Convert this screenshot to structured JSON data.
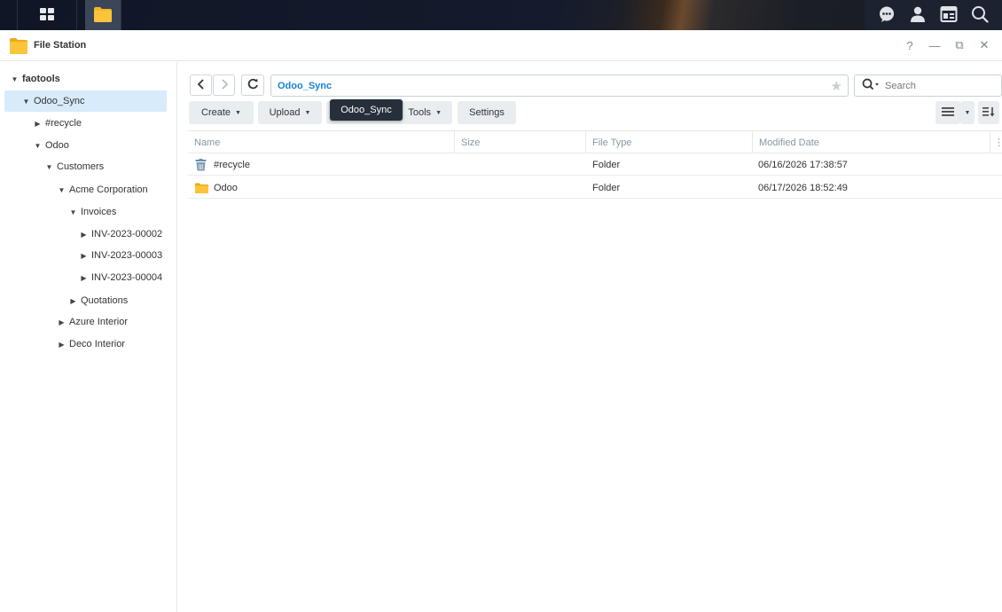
{
  "taskbar": {
    "main_menu_icon": "grid-icon",
    "app_icon": "folder-icon",
    "right_icons": [
      "chat-icon",
      "user-icon",
      "widgets-icon",
      "search-icon"
    ]
  },
  "window": {
    "title": "File Station",
    "controls": {
      "help": "?",
      "minimize": "—",
      "restore": "⧉",
      "close": "✕"
    }
  },
  "sidebar": {
    "root": "faotools",
    "items": [
      {
        "label": "Odoo_Sync",
        "expanded": true,
        "selected": true
      },
      {
        "label": "#recycle",
        "expanded": false
      },
      {
        "label": "Odoo",
        "expanded": true
      },
      {
        "label": "Customers",
        "expanded": true
      },
      {
        "label": "Acme Corporation",
        "expanded": true
      },
      {
        "label": "Invoices",
        "expanded": true
      },
      {
        "label": "INV-2023-00002",
        "expanded": false
      },
      {
        "label": "INV-2023-00003",
        "expanded": false
      },
      {
        "label": "INV-2023-00004",
        "expanded": false
      },
      {
        "label": "Quotations",
        "expanded": false
      },
      {
        "label": "Azure Interior",
        "expanded": false
      },
      {
        "label": "Deco Interior",
        "expanded": false
      }
    ]
  },
  "path": {
    "current": "Odoo_Sync",
    "search_placeholder": "Search"
  },
  "toolbar": {
    "create": "Create",
    "upload": "Upload",
    "tools": "Tools",
    "settings": "Settings",
    "tooltip": "Odoo_Sync"
  },
  "table": {
    "columns": [
      "Name",
      "Size",
      "File Type",
      "Modified Date"
    ],
    "rows": [
      {
        "icon": "trash-icon",
        "name": "#recycle",
        "size": "",
        "type": "Folder",
        "modified": "06/16/2026 17:38:57"
      },
      {
        "icon": "folder-icon",
        "name": "Odoo",
        "size": "",
        "type": "Folder",
        "modified": "06/17/2026 18:52:49"
      }
    ]
  },
  "colors": {
    "accent": "#1783d8",
    "selection": "#d7ebfb",
    "folder": "#f5b625"
  }
}
